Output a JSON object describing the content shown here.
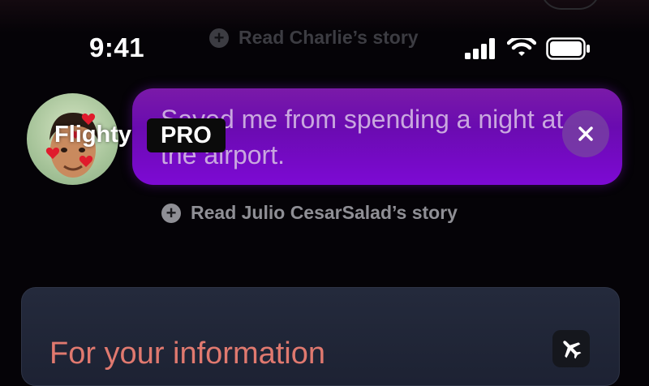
{
  "status_bar": {
    "time": "9:41",
    "icons": [
      "signal-icon",
      "wifi-icon",
      "battery-icon"
    ]
  },
  "stories": {
    "previous_link": "Read Charlie’s story",
    "current": {
      "quote": "Saved me from spending a night at the airport.",
      "read_link": "Read Julio CesarSalad’s story"
    }
  },
  "brand": {
    "name": "Flighty",
    "badge": "PRO"
  },
  "info_card": {
    "title": "For your information",
    "icon": "airplane-icon"
  },
  "colors": {
    "background": "#050307",
    "bubble": "#7d0ad4",
    "info_title": "#e0796f",
    "card": "#242a3c"
  }
}
